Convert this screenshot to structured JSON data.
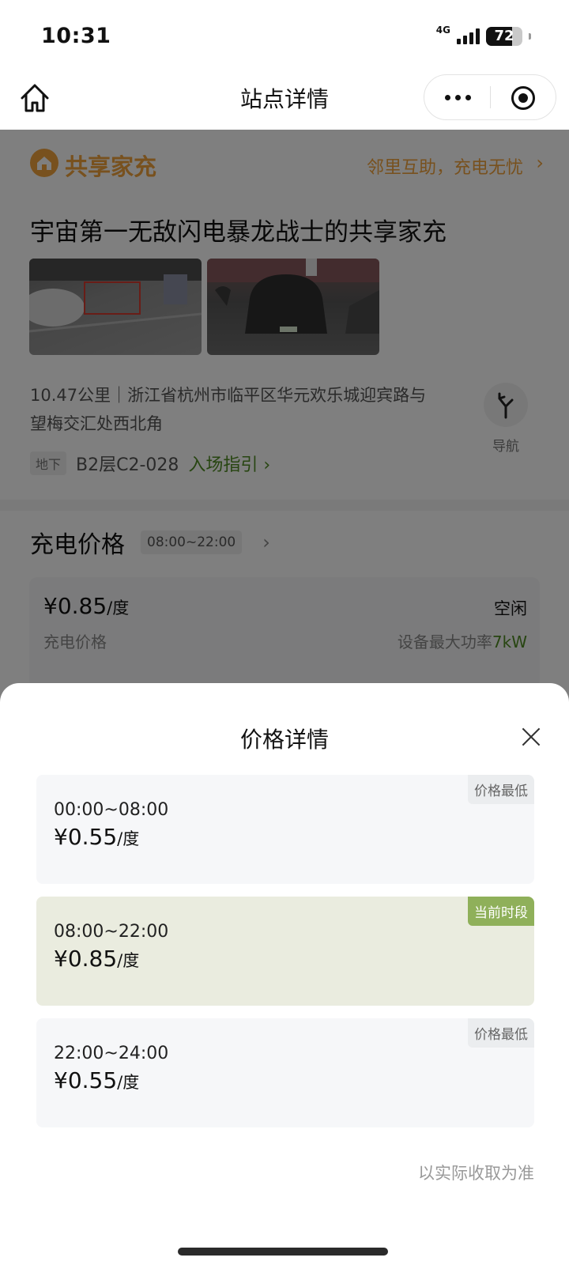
{
  "status_bar": {
    "time": "10:31",
    "network": "4G",
    "battery_level": "72",
    "battery_fraction": 0.72
  },
  "nav": {
    "title": "站点详情",
    "home_icon": "home-icon",
    "more_icon": "more-dots-icon",
    "target_icon": "target-icon"
  },
  "station": {
    "brand_name": "共享家充",
    "brand_slogan": "邻里互助，充电无忧",
    "name": "宇宙第一无敌闪电暴龙战士的共享家充",
    "address": "10.47公里｜浙江省杭州市临平区华元欢乐城迎宾路与望梅交汇处西北角",
    "navigate_label": "导航",
    "floor_tag": "地下",
    "floor_code": "B2层C2-028",
    "entry_guide": "入场指引"
  },
  "price_section": {
    "title": "充电价格",
    "current_period": "08:00~22:00",
    "current_price": "¥0.85",
    "unit": "/度",
    "price_label": "充电价格",
    "status": "空闲",
    "max_power_label": "设备最大功率",
    "max_power_value": "7kW"
  },
  "sheet": {
    "title": "价格详情",
    "tiers": [
      {
        "time": "00:00~08:00",
        "price": "¥0.55",
        "unit": "/度",
        "badge": "价格最低"
      },
      {
        "time": "08:00~22:00",
        "price": "¥0.85",
        "unit": "/度",
        "badge": "当前时段"
      },
      {
        "time": "22:00~24:00",
        "price": "¥0.55",
        "unit": "/度",
        "badge": "价格最低"
      }
    ],
    "note": "以实际收取为准"
  },
  "colors": {
    "brand_orange": "#f0a23c",
    "accent_green": "#4f8a22",
    "current_badge": "#8fb05a",
    "current_tier_bg": "#eaecdf"
  }
}
